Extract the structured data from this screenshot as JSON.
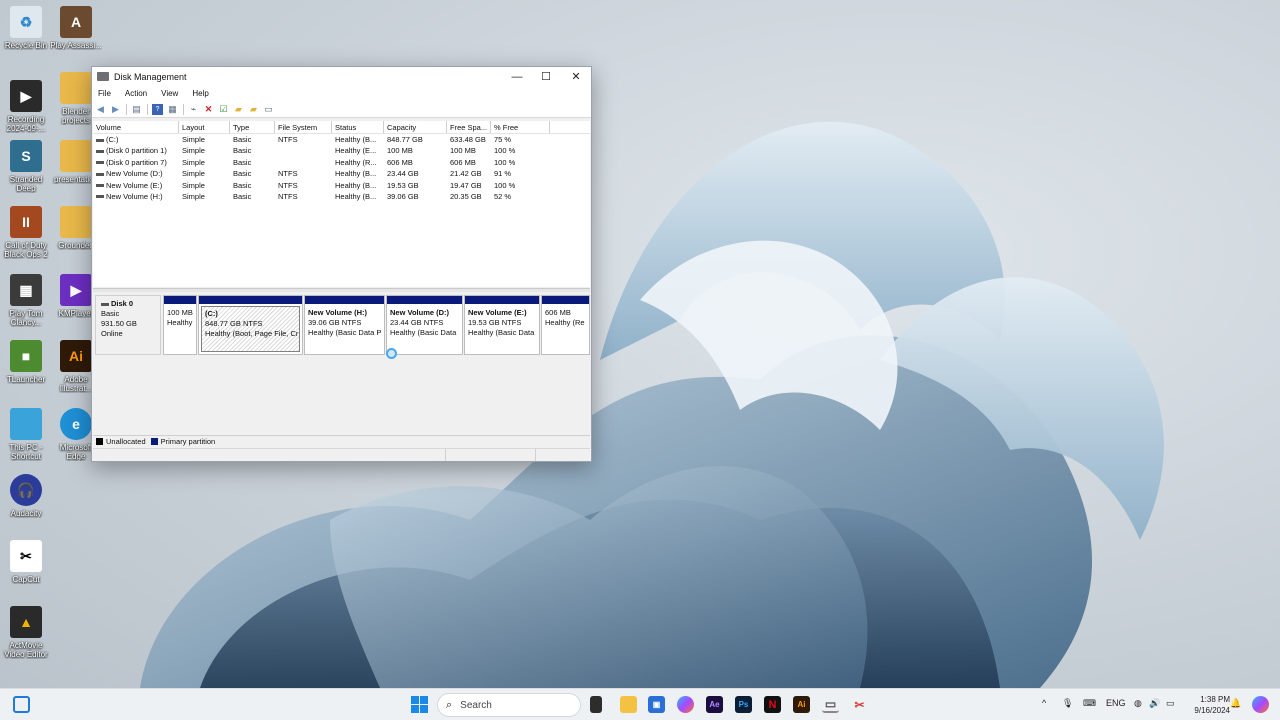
{
  "desktop": {
    "icons": [
      {
        "label": "Recycle Bin",
        "color": "#dfe7ef"
      },
      {
        "label": "Play Assassi...",
        "color": "#6b4a2f"
      },
      {
        "label": "Recording 2024-09-...",
        "color": "#2a2a2a"
      },
      {
        "label": "Blender projects",
        "color": "#e9b84a"
      },
      {
        "label": "Stranded Deep",
        "color": "#2f6e8f"
      },
      {
        "label": "presentation",
        "color": "#e9b84a"
      },
      {
        "label": "Call of Duty Black Ops 2",
        "color": "#a3481f"
      },
      {
        "label": "Grounded",
        "color": "#e9b84a"
      },
      {
        "label": "Play Tom Clancy...",
        "color": "#3b3b3b"
      },
      {
        "label": "KMPlayer",
        "color": "#6d2ec2"
      },
      {
        "label": "TLauncher",
        "color": "#4c8b2f"
      },
      {
        "label": "Adobe Illustrat...",
        "color": "#2f1a08"
      },
      {
        "label": "This PC - Shortcut",
        "color": "#3aa3d9"
      },
      {
        "label": "Microsoft Edge",
        "color": "#1f8fd6"
      },
      {
        "label": "Audacity",
        "color": "#2b3c9a"
      },
      {
        "label": "CapCut",
        "color": "#ffffff"
      },
      {
        "label": "ActMovie Video Editor",
        "color": "#2a2a2a"
      }
    ]
  },
  "window": {
    "title": "Disk Management",
    "controls": {
      "minimize": "—",
      "maximize": "☐",
      "close": "✕"
    },
    "menu": [
      "File",
      "Action",
      "View",
      "Help"
    ],
    "columns": [
      "Volume",
      "Layout",
      "Type",
      "File System",
      "Status",
      "Capacity",
      "Free Spa...",
      "% Free"
    ],
    "rows": [
      [
        "(C:)",
        "Simple",
        "Basic",
        "NTFS",
        "Healthy (B...",
        "848.77 GB",
        "633.48 GB",
        "75 %"
      ],
      [
        "(Disk 0 partition 1)",
        "Simple",
        "Basic",
        "",
        "Healthy (E...",
        "100 MB",
        "100 MB",
        "100 %"
      ],
      [
        "(Disk 0 partition 7)",
        "Simple",
        "Basic",
        "",
        "Healthy (R...",
        "606 MB",
        "606 MB",
        "100 %"
      ],
      [
        "New Volume (D:)",
        "Simple",
        "Basic",
        "NTFS",
        "Healthy (B...",
        "23.44 GB",
        "21.42 GB",
        "91 %"
      ],
      [
        "New Volume (E:)",
        "Simple",
        "Basic",
        "NTFS",
        "Healthy (B...",
        "19.53 GB",
        "19.47 GB",
        "100 %"
      ],
      [
        "New Volume (H:)",
        "Simple",
        "Basic",
        "NTFS",
        "Healthy (B...",
        "39.06 GB",
        "20.35 GB",
        "52 %"
      ]
    ],
    "disk": {
      "name": "Disk 0",
      "type": "Basic",
      "size": "931.50 GB",
      "state": "Online"
    },
    "partitions": [
      {
        "name": "",
        "size": "100 MB",
        "status": "Healthy"
      },
      {
        "name": "(C:)",
        "size": "848.77 GB NTFS",
        "status": "Healthy (Boot, Page File, Cr"
      },
      {
        "name": "New Volume  (H:)",
        "size": "39.06 GB NTFS",
        "status": "Healthy (Basic Data P"
      },
      {
        "name": "New Volume  (D:)",
        "size": "23.44 GB NTFS",
        "status": "Healthy (Basic Data"
      },
      {
        "name": "New Volume  (E:)",
        "size": "19.53 GB NTFS",
        "status": "Healthy (Basic Data"
      },
      {
        "name": "",
        "size": "606 MB",
        "status": "Healthy (Re"
      }
    ],
    "legend": {
      "unallocated": "Unallocated",
      "primary": "Primary partition"
    },
    "colors": {
      "primary": "#0a1a7a",
      "unallocated": "#000000"
    }
  },
  "taskbar": {
    "search_placeholder": "Search",
    "language": "ENG",
    "time": "1:38 PM",
    "date": "9/16/2024",
    "apps": [
      "Task View",
      "File Explorer",
      "Microsoft Store",
      "Copilot",
      "After Effects",
      "Photoshop",
      "Netflix",
      "Illustrator",
      "Disk Management",
      "Snipping Tool"
    ]
  }
}
